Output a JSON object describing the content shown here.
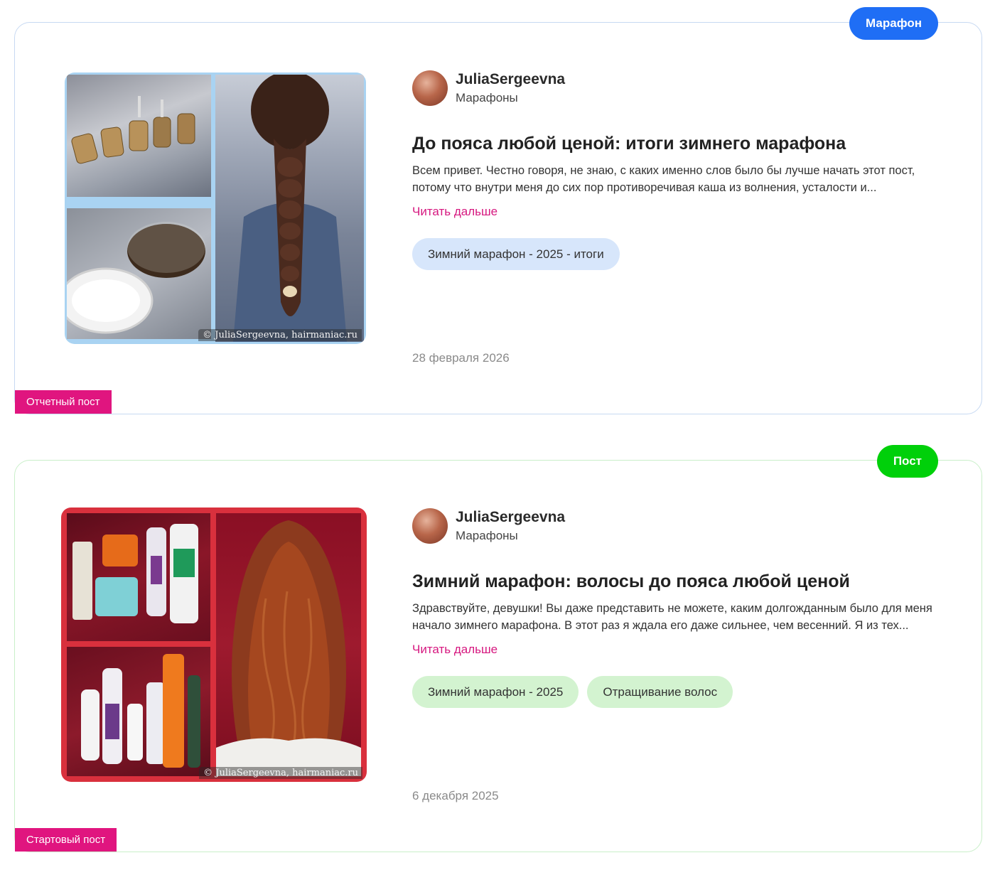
{
  "posts": [
    {
      "type_badge": "Марафон",
      "kind_label": "Отчетный пост",
      "author": {
        "name": "JuliaSergeevna",
        "group": "Марафоны"
      },
      "title": "До пояса любой ценой: итоги зимнего марафона",
      "excerpt": "Всем привет. Честно говоря, не знаю, с каких именно слов было бы лучше начать этот пост, потому что внутри меня до сих пор противоречивая каша из волнения, усталости и...",
      "read_more": "Читать дальше",
      "tags": [
        "Зимний марафон - 2025 - итоги"
      ],
      "date": "28 февраля 2026",
      "watermark": "© JuliaSergeevna, hairmaniac.ru",
      "accent": "#1f6ef5"
    },
    {
      "type_badge": "Пост",
      "kind_label": "Стартовый пост",
      "author": {
        "name": "JuliaSergeevna",
        "group": "Марафоны"
      },
      "title": "Зимний марафон: волосы до пояса любой ценой",
      "excerpt": "Здравствуйте, девушки! Вы даже представить не можете, каким долгожданным было для меня начало зимнего марафона. В этот раз я ждала его даже сильнее, чем весенний. Я из тех...",
      "read_more": "Читать дальше",
      "tags": [
        "Зимний марафон - 2025",
        "Отращивание волос"
      ],
      "date": "6 декабря 2025",
      "watermark": "© JuliaSergeevna, hairmaniac.ru",
      "accent": "#00d00a"
    }
  ],
  "colors": {
    "kind_badge": "#e0157f",
    "read_more": "#d6177f",
    "date": "#8a8a8a"
  }
}
